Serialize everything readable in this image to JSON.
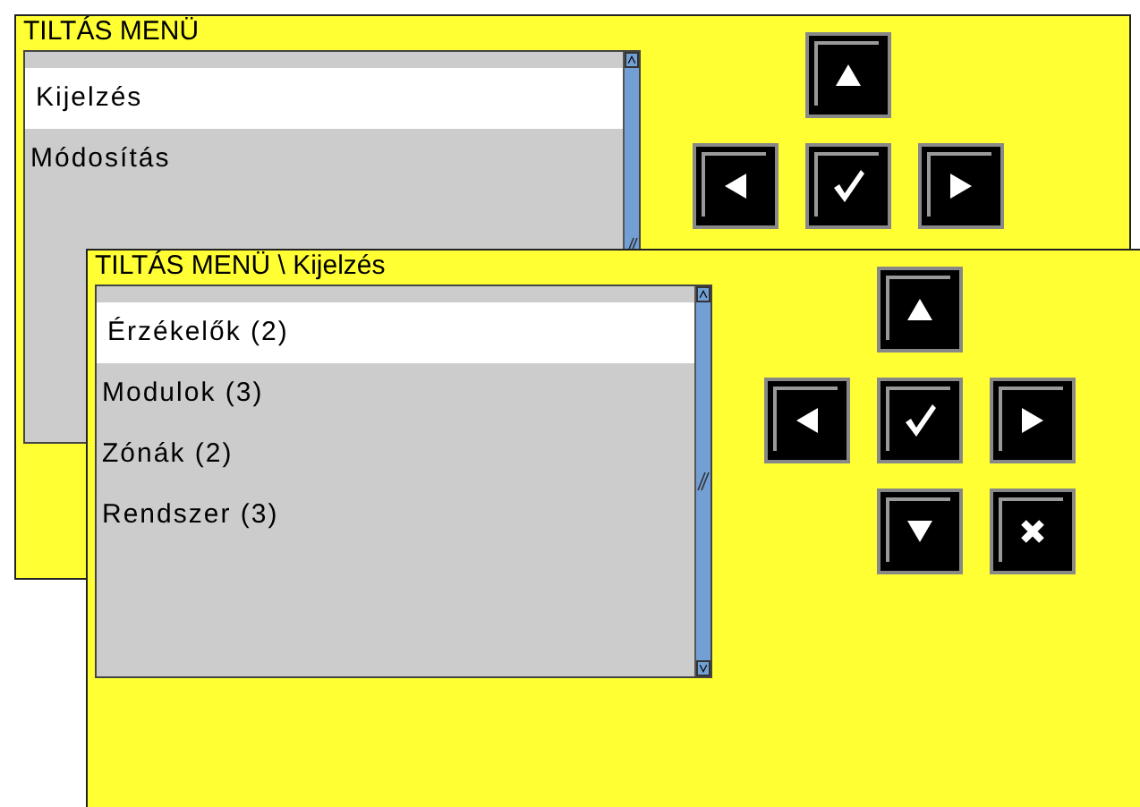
{
  "windows": [
    {
      "title": "TILTÁS MENÜ",
      "items": [
        {
          "label": "Kijelzés",
          "selected": true
        },
        {
          "label": "Módosítás",
          "selected": false
        }
      ],
      "buttons": [
        {
          "kind": "up"
        },
        {
          "kind": "left"
        },
        {
          "kind": "ok"
        },
        {
          "kind": "right"
        }
      ]
    },
    {
      "title": "TILTÁS MENÜ \\ Kijelzés",
      "items": [
        {
          "label": "Érzékelők (2)",
          "selected": true
        },
        {
          "label": "Modulok (3)",
          "selected": false
        },
        {
          "label": "Zónák (2)",
          "selected": false
        },
        {
          "label": "Rendszer (3)",
          "selected": false
        }
      ],
      "buttons": [
        {
          "kind": "up"
        },
        {
          "kind": "left"
        },
        {
          "kind": "ok"
        },
        {
          "kind": "right"
        },
        {
          "kind": "down"
        },
        {
          "kind": "cancel"
        }
      ]
    }
  ]
}
